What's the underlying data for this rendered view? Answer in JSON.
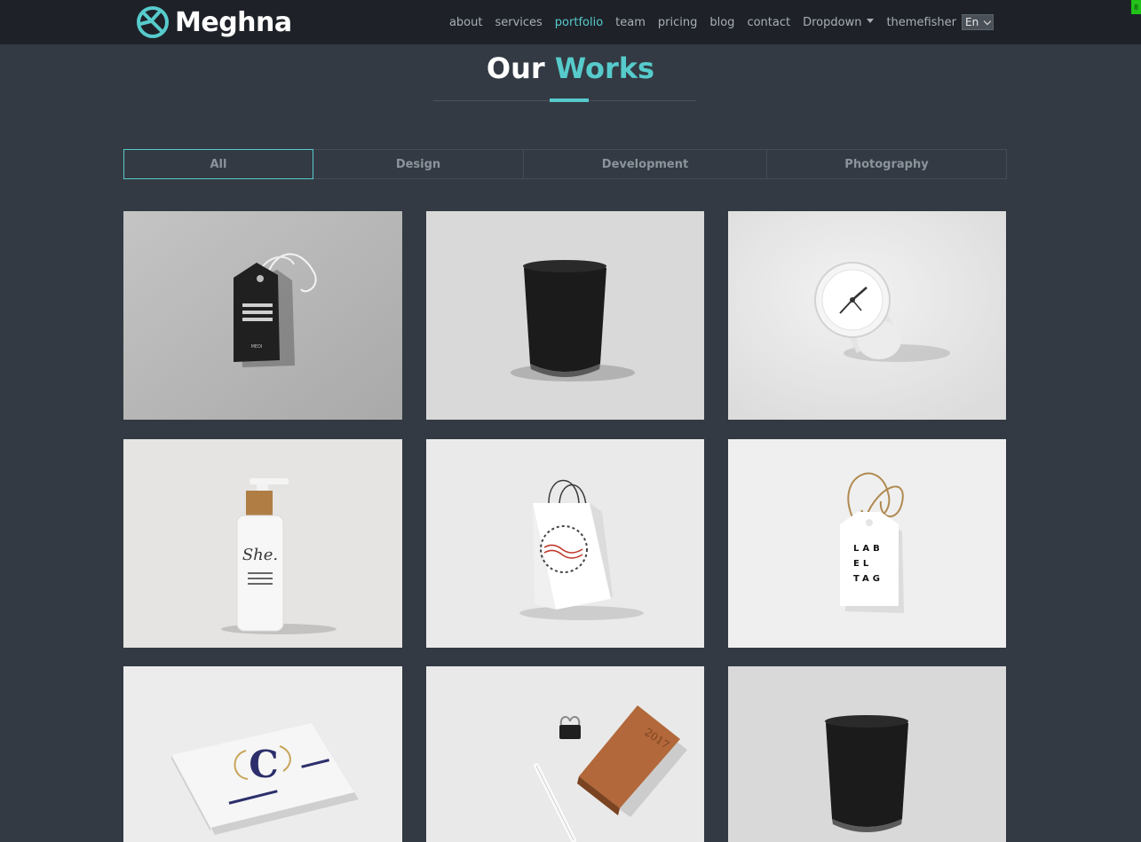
{
  "brand": {
    "name": "Meghna",
    "accent": "#57cbcc"
  },
  "nav": {
    "items": [
      {
        "label": "about",
        "active": false
      },
      {
        "label": "services",
        "active": false
      },
      {
        "label": "portfolio",
        "active": true
      },
      {
        "label": "team",
        "active": false
      },
      {
        "label": "pricing",
        "active": false
      },
      {
        "label": "blog",
        "active": false
      },
      {
        "label": "contact",
        "active": false
      },
      {
        "label": "Dropdown",
        "active": false
      },
      {
        "label": "themefisher",
        "active": false
      }
    ],
    "language": "En",
    "corner_badge": "8"
  },
  "section": {
    "title_plain": "Our",
    "title_accent": "Works"
  },
  "filters": [
    {
      "label": "All",
      "active": true
    },
    {
      "label": "Design",
      "active": false
    },
    {
      "label": "Development",
      "active": false
    },
    {
      "label": "Photography",
      "active": false
    }
  ],
  "portfolio": [
    {
      "item": "hang-tag-black",
      "tag_text": "MEDI"
    },
    {
      "item": "speaker-black"
    },
    {
      "item": "desk-clock"
    },
    {
      "item": "shampoo-bottle",
      "label": "She."
    },
    {
      "item": "shopping-bag"
    },
    {
      "item": "label-tag",
      "lines": [
        "LAB",
        "EL",
        "TAG"
      ]
    },
    {
      "item": "business-card",
      "letter": "C"
    },
    {
      "item": "notebook-clip",
      "year": "2017"
    },
    {
      "item": "speaker-black"
    }
  ]
}
